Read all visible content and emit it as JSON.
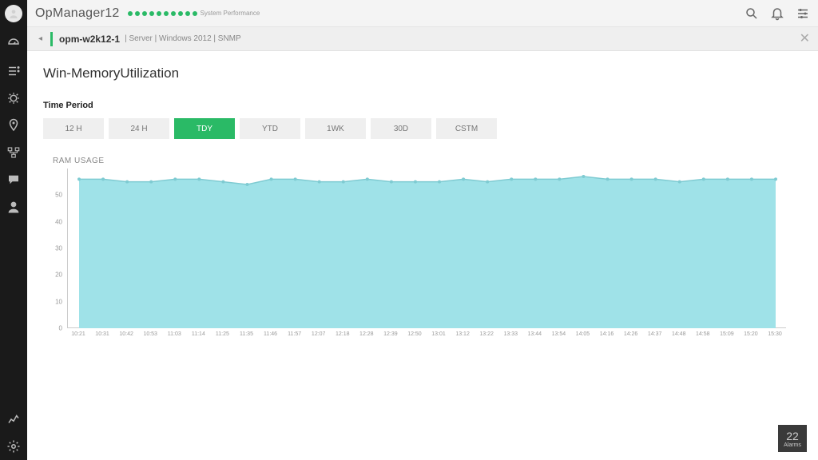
{
  "app": {
    "title": "OpManager12",
    "perf_label": "System Performance",
    "perf_dot_count": 10
  },
  "breadcrumb": {
    "device": "opm-w2k12-1",
    "meta": [
      "Server",
      "Windows 2012",
      "SNMP"
    ]
  },
  "page": {
    "title": "Win-MemoryUtilization"
  },
  "period": {
    "label": "Time Period",
    "options": [
      "12 H",
      "24 H",
      "TDY",
      "YTD",
      "1WK",
      "30D",
      "CSTM"
    ],
    "active": "TDY"
  },
  "alarms": {
    "count": "22",
    "label": "Alarms"
  },
  "chart_data": {
    "type": "area",
    "title": "RAM USAGE",
    "series": "RAM Usage",
    "ylabel": "",
    "xlabel": "",
    "ylim": [
      0,
      60
    ],
    "y_ticks": [
      0,
      10,
      20,
      30,
      40,
      50
    ],
    "x": [
      "10:21",
      "10:31",
      "10:42",
      "10:53",
      "11:03",
      "11:14",
      "11:25",
      "11:35",
      "11:46",
      "11:57",
      "12:07",
      "12:18",
      "12:28",
      "12:39",
      "12:50",
      "13:01",
      "13:12",
      "13:22",
      "13:33",
      "13:44",
      "13:54",
      "14:05",
      "14:16",
      "14:26",
      "14:37",
      "14:48",
      "14:58",
      "15:09",
      "15:20",
      "15:30"
    ],
    "values": [
      56,
      56,
      55,
      55,
      56,
      56,
      55,
      54,
      56,
      56,
      55,
      55,
      56,
      55,
      55,
      55,
      56,
      55,
      56,
      56,
      56,
      57,
      56,
      56,
      56,
      55,
      56,
      56,
      56,
      56
    ],
    "fill_color": "#9fe2e8",
    "line_color": "#7fcbd2"
  }
}
